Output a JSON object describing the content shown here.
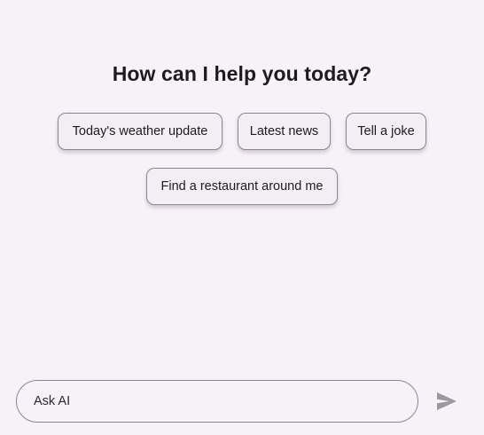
{
  "heading": "How can I help you today?",
  "suggestions": [
    "Today's weather update",
    "Latest news",
    "Tell a joke",
    "Find a restaurant around me"
  ],
  "input": {
    "placeholder": "Ask AI",
    "value": ""
  },
  "icons": {
    "send": "send-icon"
  },
  "colors": {
    "background": "#f7f1f8",
    "chip_background": "#f3eef4",
    "border": "#8a8690",
    "send_icon": "#9b979f",
    "text": "#1d1b20"
  }
}
